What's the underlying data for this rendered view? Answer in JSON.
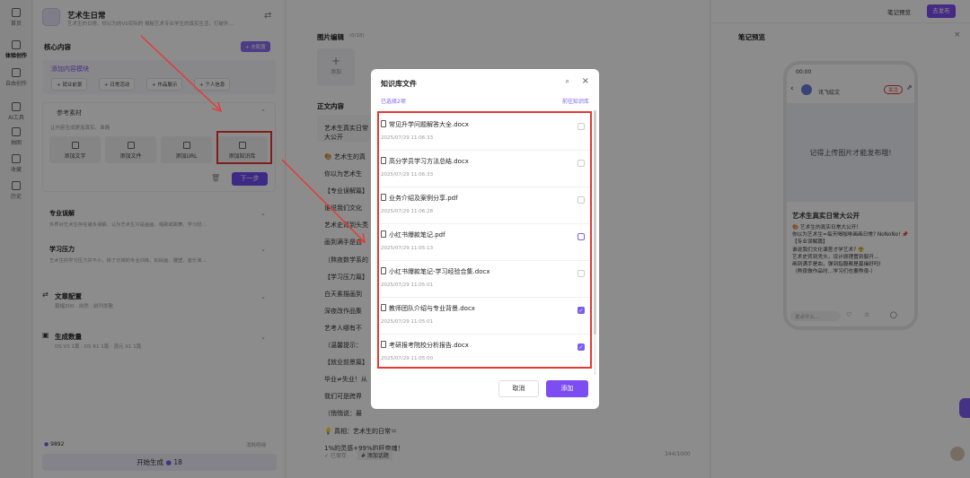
{
  "rail": [
    {
      "label": "首页"
    },
    {
      "label": "体验创作"
    },
    {
      "label": "自由创作"
    },
    {
      "label": "AI工具"
    },
    {
      "label": "抽图"
    },
    {
      "label": "收藏"
    },
    {
      "label": "历史"
    }
  ],
  "app": {
    "title": "艺术生日常",
    "subtitle": "艺术生的日常、你以为的VS实际的 揭秘艺术专业学生的真实生活，打破外…"
  },
  "core": {
    "title": "核心内容",
    "upload": "+ 去配置",
    "add_module": "添加内容模块",
    "pills": [
      "+ 就业前景",
      "+ 日常活动",
      "+ 作品展示",
      "+ 个人信息"
    ]
  },
  "ref": {
    "title": "参考素材",
    "desc": "让内容生成更加真实、准确",
    "tiles": [
      "添加文字",
      "添加文件",
      "添加URL",
      "添加知识库"
    ],
    "next": "下一步"
  },
  "sections": [
    {
      "title": "专业误解",
      "desc": "外界对艺术生存在诸多误解，认为艺术生只是画画、唱歌或跳舞，学习轻…"
    },
    {
      "title": "学习压力",
      "desc": "艺术生的学习压力并不小，除了日常的专业训练，如绘画、雕塑、音乐演…"
    }
  ],
  "config": {
    "title": "文章配置",
    "desc": "篇幅300 · 自然 · 前列发散"
  },
  "gen": {
    "title": "生成数量",
    "desc": "DS V3 1篇 · DS R1 1篇 · 混元 X1 1篇"
  },
  "bottom": {
    "points": "9892",
    "model": "消耗明细",
    "generate": "开始生成",
    "cost": "18"
  },
  "center": {
    "img_title": "图片编辑",
    "img_count": "(0/18)",
    "add": "添加",
    "body_title": "正文内容",
    "title_input": "艺术生真实日常大公开",
    "lines": [
      "🎨 艺术生的真",
      "你以为艺术生",
      "【专业误解篇】",
      "谁说我们文化",
      "艺术史背到头秃",
      "画到满手是血",
      "（熬夜数学系的",
      "【学习压力篇】",
      "白天素描画到",
      "深夜改作品集",
      "艺考人哪有不",
      "（温馨提示：",
      "【就业前景篇】",
      "毕业≠失业！从",
      "我们可是跨界",
      "（悄悄说：最",
      "💡 真相：艺术生的日常＝",
      "1%的灵感+99%的肝帝魂！"
    ],
    "saved": "✓ 已保存",
    "topic": "# 添加话题",
    "count": "344/1000"
  },
  "right": {
    "topbar_preview": "笔记预览",
    "publish": "去发布",
    "title": "笔记预览",
    "time": "00:00",
    "user": "讯飞绘文",
    "follow": "关注",
    "placeholder": "记得上传图片才能发布哦!",
    "note_title": "艺术生真实日常大公开",
    "note_lines": [
      "🎨 艺术生的真实日常大公开!",
      "你以为艺术生=每天喝咖啡画画日常? NoNoNo! 📌",
      "【专业误解篇】",
      "谁说我们文化课差才学艺术? 😤",
      "艺术史背到秃头，设计原理置到裂开…",
      "画到满手是血，弹到指腹都是基操好吗!",
      "（熬夜做作品时…学习们也要熬夜-）"
    ],
    "say": "说点什么..."
  },
  "modal": {
    "title": "知识库文件",
    "selected": "已选择2项",
    "go": "前往知识库",
    "cancel": "取消",
    "add": "添加",
    "files": [
      {
        "name": "常见升学问题解答大全.docx",
        "date": "2025/07/29 11:06:33",
        "checked": false
      },
      {
        "name": "高分学员学习方法总结.docx",
        "date": "2025/07/29 11:06:33",
        "checked": false
      },
      {
        "name": "业务介绍及案例分享.pdf",
        "date": "2025/07/29 11:06:28",
        "checked": false
      },
      {
        "name": "小红书爆款笔记.pdf",
        "date": "2025/07/29 11:05:13",
        "checked": false
      },
      {
        "name": "小红书爆款笔记-学习经验合集.docx",
        "date": "2025/07/29 11:05:01",
        "checked": false
      },
      {
        "name": "教师团队介绍与专业背景.docx",
        "date": "2025/07/29 11:05:01",
        "checked": true
      },
      {
        "name": "考研报考院校分析报告.docx",
        "date": "2025/07/29 11:05:00",
        "checked": true
      }
    ]
  },
  "colors": {
    "accent": "#7c4df0",
    "highlight": "#e53935"
  }
}
